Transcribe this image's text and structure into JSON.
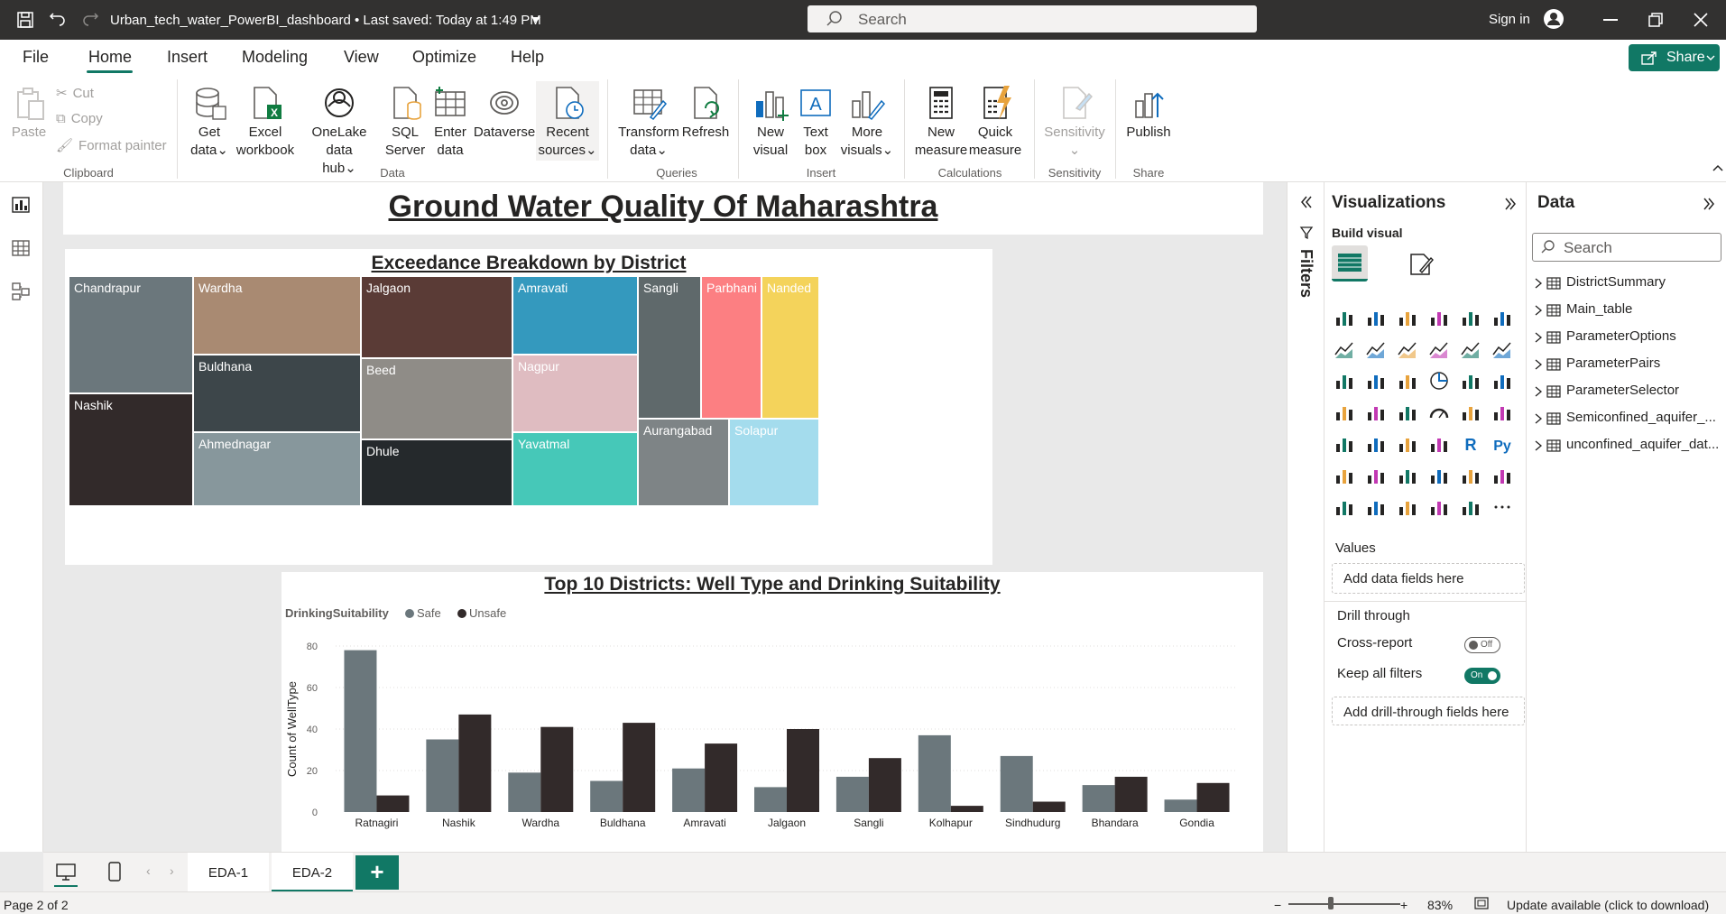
{
  "titlebar": {
    "doc_title": "Urban_tech_water_PowerBI_dashboard • Last saved: Today at 1:49 PM",
    "search_placeholder": "Search",
    "signin": "Sign in"
  },
  "ribbon_tabs": [
    "File",
    "Home",
    "Insert",
    "Modeling",
    "View",
    "Optimize",
    "Help"
  ],
  "share_label": "Share",
  "ribbon": {
    "clipboard": {
      "paste": "Paste",
      "cut": "Cut",
      "copy": "Copy",
      "format_painter": "Format painter",
      "label": "Clipboard"
    },
    "data": {
      "get_data": [
        "Get",
        "data"
      ],
      "excel": [
        "Excel",
        "workbook"
      ],
      "onelake": [
        "OneLake data",
        "hub"
      ],
      "sql": [
        "SQL",
        "Server"
      ],
      "enter": [
        "Enter",
        "data"
      ],
      "dataverse": "Dataverse",
      "recent": [
        "Recent",
        "sources"
      ],
      "label": "Data"
    },
    "queries": {
      "transform": [
        "Transform",
        "data"
      ],
      "refresh": "Refresh",
      "label": "Queries"
    },
    "insert": {
      "new_visual": [
        "New",
        "visual"
      ],
      "text_box": [
        "Text",
        "box"
      ],
      "more_visuals": [
        "More",
        "visuals"
      ],
      "label": "Insert"
    },
    "calculations": {
      "new_measure": [
        "New",
        "measure"
      ],
      "quick_measure": [
        "Quick",
        "measure"
      ],
      "label": "Calculations"
    },
    "sensitivity": {
      "button": "Sensitivity",
      "label": "Sensitivity"
    },
    "share": {
      "publish": "Publish",
      "label": "Share"
    }
  },
  "report": {
    "title": "Ground Water Quality Of Maharashtra",
    "treemap": {
      "title": "Exceedance Breakdown by District",
      "tiles": [
        {
          "name": "Chandrapur",
          "color": "#6b777c"
        },
        {
          "name": "Nashik",
          "color": "#322a2a"
        },
        {
          "name": "Wardha",
          "color": "#a98a72"
        },
        {
          "name": "Buldhana",
          "color": "#3d464a"
        },
        {
          "name": "Ahmednagar",
          "color": "#87979c"
        },
        {
          "name": "Jalgaon",
          "color": "#5a3b36"
        },
        {
          "name": "Beed",
          "color": "#8f8c87"
        },
        {
          "name": "Dhule",
          "color": "#25292c"
        },
        {
          "name": "Amravati",
          "color": "#3499be"
        },
        {
          "name": "Nagpur",
          "color": "#dfbcc1"
        },
        {
          "name": "Yavatmal",
          "color": "#46c8b8"
        },
        {
          "name": "Sangli",
          "color": "#5f696b"
        },
        {
          "name": "Parbhani",
          "color": "#fc7f82"
        },
        {
          "name": "Nanded",
          "color": "#f4d35b"
        },
        {
          "name": "Aurangabad",
          "color": "#7e8486"
        },
        {
          "name": "Solapur",
          "color": "#a4dced"
        }
      ]
    }
  },
  "chart_data": {
    "type": "bar",
    "title": "Top 10 Districts: Well Type and Drinking Suitability",
    "legend_title": "DrinkingSuitability",
    "xlabel": "",
    "ylabel": "Count of WellType",
    "ylim": [
      0,
      80
    ],
    "yticks": [
      0,
      20,
      40,
      60,
      80
    ],
    "grid": true,
    "legend_position": "top-left",
    "categories": [
      "Ratnagiri",
      "Nashik",
      "Wardha",
      "Buldhana",
      "Amravati",
      "Jalgaon",
      "Sangli",
      "Kolhapur",
      "Sindhudurg",
      "Bhandara",
      "Gondia"
    ],
    "series": [
      {
        "name": "Safe",
        "color": "#6b777c",
        "values": [
          78,
          35,
          19,
          15,
          21,
          12,
          17,
          37,
          27,
          13,
          6
        ]
      },
      {
        "name": "Unsafe",
        "color": "#322a2a",
        "values": [
          8,
          47,
          41,
          43,
          33,
          40,
          26,
          3,
          5,
          17,
          14
        ]
      }
    ]
  },
  "filters_label": "Filters",
  "visualizations": {
    "title": "Visualizations",
    "build_visual": "Build visual",
    "values_label": "Values",
    "values_placeholder": "Add data fields here",
    "drill_through": "Drill through",
    "cross_report": "Cross-report",
    "cross_report_state": "Off",
    "keep_all_filters": "Keep all filters",
    "keep_all_filters_state": "On",
    "drill_placeholder": "Add drill-through fields here"
  },
  "data_pane": {
    "title": "Data",
    "search_placeholder": "Search",
    "tables": [
      "DistrictSummary",
      "Main_table",
      "ParameterOptions",
      "ParameterPairs",
      "ParameterSelector",
      "Semiconfined_aquifer_...",
      "unconfined_aquifer_dat..."
    ]
  },
  "page_tabs": [
    "EDA-1",
    "EDA-2"
  ],
  "add_page_label": "+",
  "status": {
    "page": "Page 2 of 2",
    "zoom": "83%",
    "update": "Update available (click to download)"
  },
  "colors": {
    "accent": "#117865",
    "titlebar": "#323130"
  }
}
